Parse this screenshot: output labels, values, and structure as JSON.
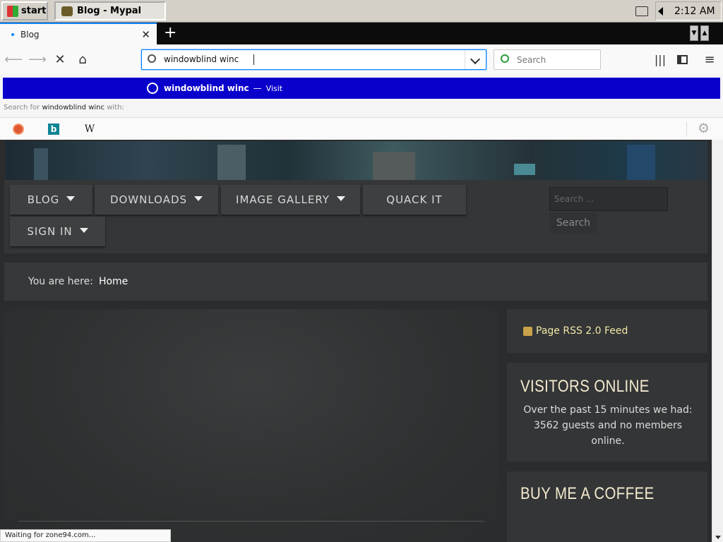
{
  "taskbar": {
    "start_label": "start",
    "task_label": "Blog - Mypal",
    "clock": "2:12 AM"
  },
  "browser": {
    "tab_title": "Blog",
    "url_text": "windowblind winc",
    "search_placeholder": "Search",
    "accent_color": "#0a84ff"
  },
  "autocomplete": {
    "title": "windowblind winc",
    "separator": "—",
    "action": "Visit",
    "search_for_prefix": "Search for",
    "search_for_term": "windowblind winc",
    "search_for_suffix": "with:",
    "engines": [
      "duckduckgo-icon",
      "bing-icon",
      "wikipedia-icon"
    ],
    "wiki_glyph": "W",
    "bing_glyph": "b",
    "highlight_color": "#0a00cc"
  },
  "site": {
    "menu": [
      {
        "label": "BLOG",
        "has_dropdown": true
      },
      {
        "label": "DOWNLOADS",
        "has_dropdown": true
      },
      {
        "label": "IMAGE GALLERY",
        "has_dropdown": true
      },
      {
        "label": "QUACK IT",
        "has_dropdown": false
      },
      {
        "label": "SIGN IN",
        "has_dropdown": true
      }
    ],
    "search_placeholder": "Search ...",
    "search_button": "Search",
    "breadcrumb_prefix": "You are here:",
    "breadcrumb_current": "Home",
    "rss_label": "Page RSS 2.0 Feed",
    "visitors_title": "VISITORS ONLINE",
    "visitors_text": "Over the past 15 minutes we had: 3562 guests and no members online.",
    "coffee_title": "BUY ME A COFFEE"
  },
  "status": {
    "text": "Waiting for zone94.com..."
  }
}
